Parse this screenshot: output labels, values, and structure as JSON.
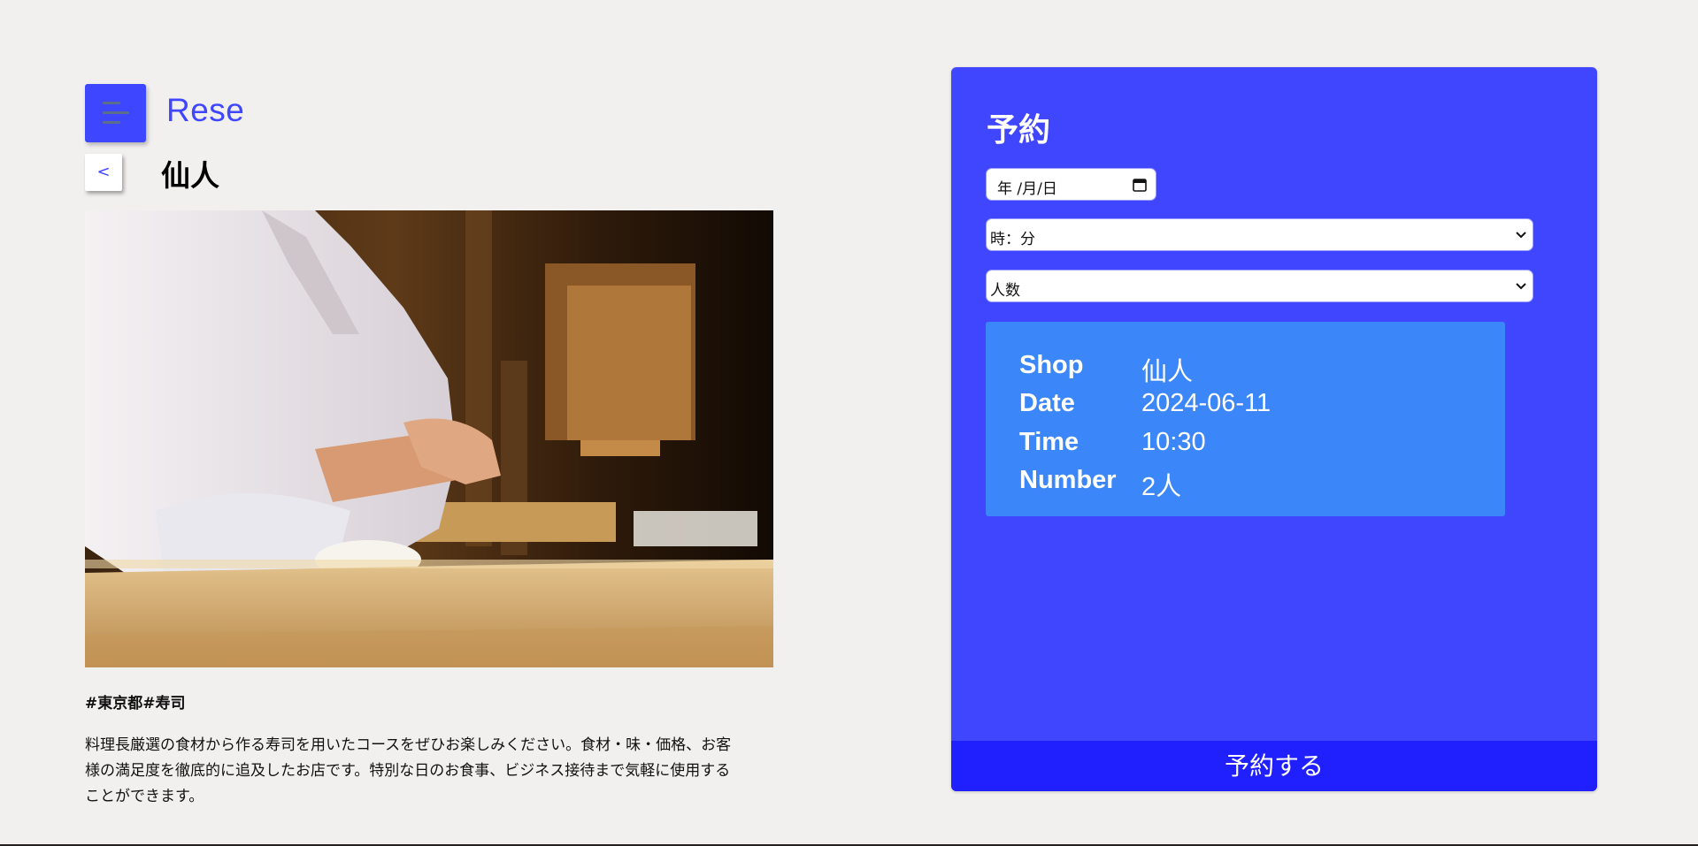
{
  "header": {
    "brand": "Rese"
  },
  "shop": {
    "back_label": "<",
    "name": "仙人",
    "tags": "#東京都#寿司",
    "description": "料理長厳選の食材から作る寿司を用いたコースをぜひお楽しみください。食材・味・価格、お客様の満足度を徹底的に追及したお店です。特別な日のお食事、ビジネス接待まで気軽に使用することができます。"
  },
  "reservation": {
    "title": "予約",
    "date_placeholder": "年 /月/日",
    "time_placeholder": "時：分",
    "people_placeholder": "人数",
    "summary": {
      "shop_label": "Shop",
      "shop_value": "仙人",
      "date_label": "Date",
      "date_value": "2024-06-11",
      "time_label": "Time",
      "time_value": "10:30",
      "number_label": "Number",
      "number_value": "2人"
    },
    "submit_label": "予約する"
  },
  "colors": {
    "accent": "#3f46ff",
    "panel": "#4046fe",
    "summary_bg": "#3b86f8",
    "submit_bg": "#2020fe",
    "page_bg": "#f2f0ef"
  },
  "icons": [
    "hamburger-menu-icon",
    "calendar-icon",
    "chevron-down-icon"
  ]
}
